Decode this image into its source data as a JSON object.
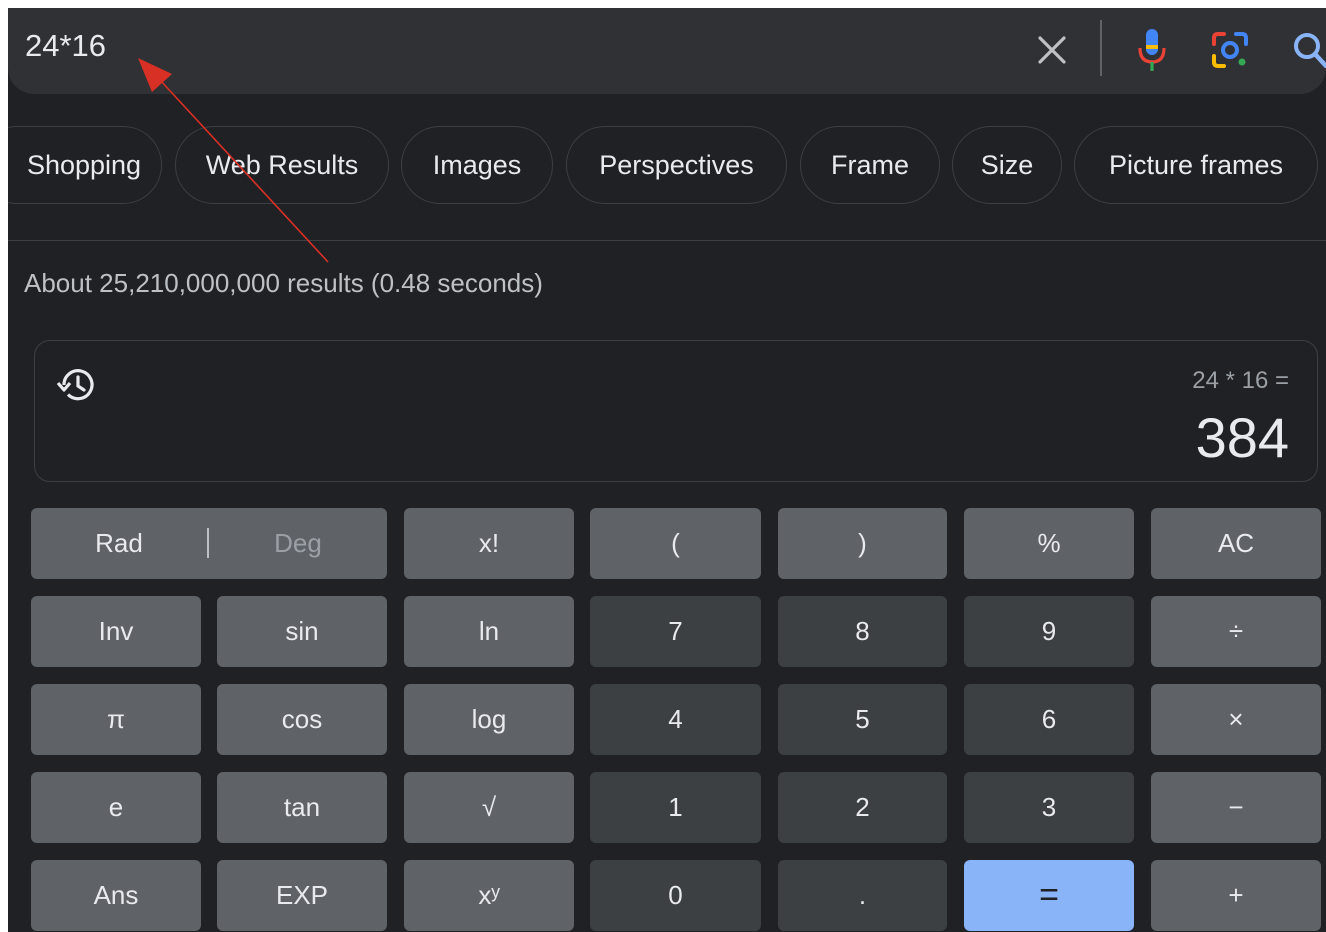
{
  "search": {
    "query": "24*16"
  },
  "chips": [
    "Shopping",
    "Web Results",
    "Images",
    "Perspectives",
    "Frame",
    "Size",
    "Picture frames"
  ],
  "results_stats": "About 25,210,000,000 results (0.48 seconds)",
  "calculator": {
    "expression": "24 * 16 =",
    "result": "384",
    "mode_rad": "Rad",
    "mode_deg": "Deg",
    "keys": {
      "fact": "x!",
      "lparen": "(",
      "rparen": ")",
      "percent": "%",
      "ac": "AC",
      "inv": "Inv",
      "sin": "sin",
      "ln": "ln",
      "seven": "7",
      "eight": "8",
      "nine": "9",
      "divide": "÷",
      "pi": "π",
      "cos": "cos",
      "log": "log",
      "four": "4",
      "five": "5",
      "six": "6",
      "multiply": "×",
      "e": "e",
      "tan": "tan",
      "sqrt": "√",
      "one": "1",
      "two": "2",
      "three": "3",
      "minus": "−",
      "ans": "Ans",
      "exp": "EXP",
      "power": "xʸ",
      "zero": "0",
      "dot": ".",
      "equals": "=",
      "plus": "+"
    }
  },
  "colors": {
    "background": "#202124",
    "search_bar": "#303134",
    "function_key": "#5f6368",
    "number_key": "#3c4043",
    "equals_key": "#8ab4f8",
    "annotation_arrow": "#d93025"
  },
  "icons": [
    "close-icon",
    "microphone-icon",
    "lens-icon",
    "search-icon",
    "history-icon"
  ]
}
